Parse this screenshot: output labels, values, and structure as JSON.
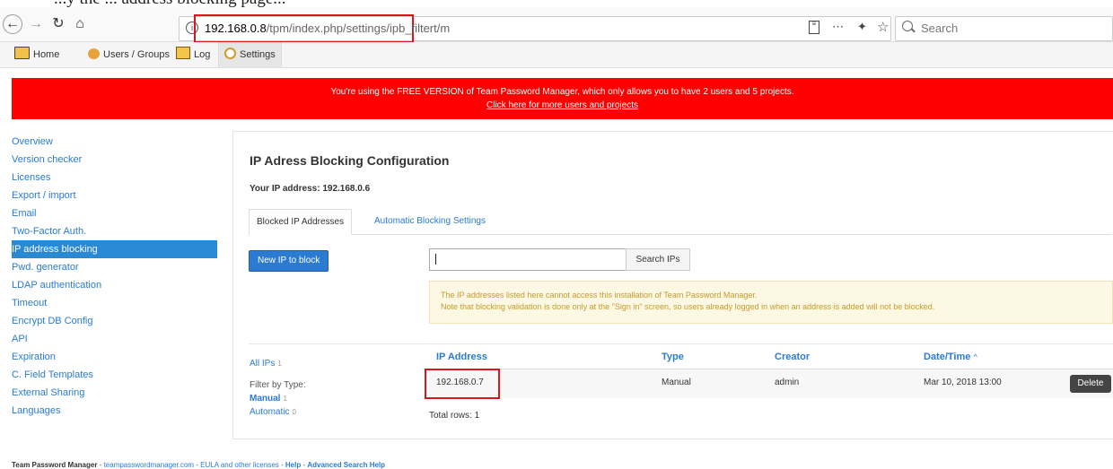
{
  "top_overlay": {
    "text": "...y the ... address blocking page..."
  },
  "browser": {
    "url_host": "192.168.0.8",
    "url_path": "/tpm/index.php/settings/ipb_filtert/m",
    "search_placeholder": "Search"
  },
  "app_nav": {
    "home": "Home",
    "users_groups": "Users / Groups",
    "log": "Log",
    "settings": "Settings"
  },
  "banner": {
    "message": "You're using the FREE VERSION of Team Password Manager, which only allows you to have 2 users and 5 projects.",
    "link": "Click here for more users and projects"
  },
  "sidebar": {
    "items": [
      "Overview",
      "Version checker",
      "Licenses",
      "Export / import",
      "Email",
      "Two-Factor Auth.",
      "IP address blocking",
      "Pwd. generator",
      "LDAP authentication",
      "Timeout",
      "Encrypt DB Config",
      "API",
      "Expiration",
      "C. Field Templates",
      "External Sharing",
      "Languages"
    ],
    "active_index": 6
  },
  "main": {
    "title": "IP Adress Blocking Configuration",
    "your_ip": "Your IP address: 192.168.0.6",
    "tabs": [
      "Blocked IP Addresses",
      "Automatic Blocking Settings"
    ],
    "new_ip_button": "New IP to block",
    "search_button": "Search IPs",
    "warning_line1": "The IP addresses listed here cannot access this installation of Team Password Manager.",
    "warning_line2": "Note that blocking validation is done only at the \"Sign in\" screen, so users already logged in when an address is added will not be blocked."
  },
  "filters": {
    "all_ips": "All IPs",
    "all_count": "1",
    "filter_by_type": "Filter by Type:",
    "manual": "Manual",
    "manual_count": "1",
    "automatic": "Automatic",
    "automatic_count": "0"
  },
  "table": {
    "headers": [
      "IP Address",
      "Type",
      "Creator",
      "Date/Time"
    ],
    "sort_indicator": "^",
    "rows": [
      {
        "ip": "192.168.0.7",
        "type": "Manual",
        "creator": "admin",
        "datetime": "Mar 10, 2018 13:00",
        "action": "Delete"
      }
    ],
    "total_rows": "Total rows: 1"
  },
  "footer": {
    "brand": "Team Password Manager",
    "site": "teampasswordmanager.com",
    "eula": "EULA and other licenses",
    "help": "Help",
    "adv_help": "Advanced Search Help",
    "sep": " - "
  },
  "colors": {
    "banner": "#ff0000",
    "link": "#2a7bd1",
    "active_sidebar": "#2a89d3",
    "highlight_box": "#d9161b"
  }
}
